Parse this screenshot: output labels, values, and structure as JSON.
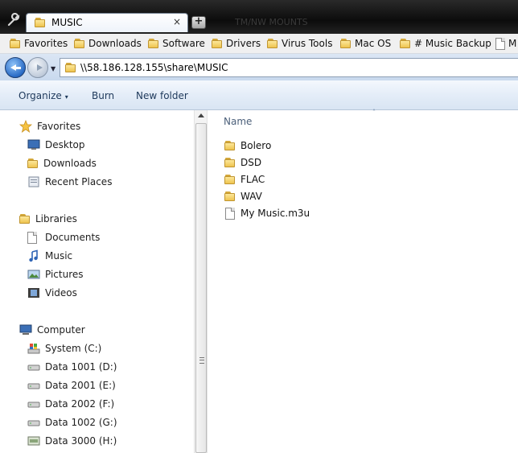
{
  "tab": {
    "title": "MUSIC",
    "close": "×",
    "new_tab": "+"
  },
  "title_bar_text": "TM/NW MOUNTS",
  "bookmarks": [
    "Favorites",
    "Downloads",
    "Software",
    "Drivers",
    "Virus Tools",
    "Mac OS",
    "# Music Backup",
    "M"
  ],
  "address": {
    "path": "\\\\58.186.128.155\\share\\MUSIC"
  },
  "toolbar": {
    "organize": "Organize",
    "organize_arrow": "▾",
    "burn": "Burn",
    "new_folder": "New folder"
  },
  "nav": {
    "favorites": {
      "label": "Favorites",
      "items": [
        "Desktop",
        "Downloads",
        "Recent Places"
      ]
    },
    "libraries": {
      "label": "Libraries",
      "items": [
        "Documents",
        "Music",
        "Pictures",
        "Videos"
      ]
    },
    "computer": {
      "label": "Computer",
      "items": [
        "System (C:)",
        "Data 1001 (D:)",
        "Data 2001 (E:)",
        "Data 2002 (F:)",
        "Data 1002 (G:)",
        "Data 3000 (H:)"
      ]
    }
  },
  "content": {
    "column_name": "Name",
    "sort_caret": "˄",
    "files": [
      {
        "name": "Bolero",
        "type": "folder"
      },
      {
        "name": "DSD",
        "type": "folder"
      },
      {
        "name": "FLAC",
        "type": "folder"
      },
      {
        "name": "WAV",
        "type": "folder"
      },
      {
        "name": "My Music.m3u",
        "type": "file"
      }
    ]
  },
  "colors": {
    "folder": "#eec44f",
    "accent": "#2a6bc5",
    "command_text": "#1e395b"
  }
}
